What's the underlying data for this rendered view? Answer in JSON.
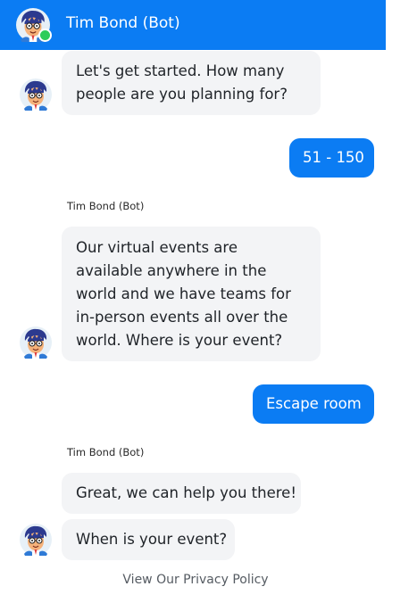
{
  "header": {
    "title": "Tim Bond (Bot)"
  },
  "messages": {
    "bot1": "Let's get started. How many people are you planning for?",
    "user1": "51 - 150",
    "sender2": "Tim Bond (Bot)",
    "bot2": "Our virtual events are available anywhere in the world and we have teams for in-person events all over the world. Where is your event?",
    "user2": "Escape room",
    "sender3": "Tim Bond (Bot)",
    "bot3a": "Great, we can help you there!",
    "bot3b": "When is your event?"
  },
  "footer": {
    "privacy_link": "View Our Privacy Policy"
  },
  "colors": {
    "brand": "#0b7cf3",
    "bubble_bot": "#f3f4f6",
    "online": "#2ecc5b"
  },
  "icons": {
    "avatar": "cartoon-agent-avatar-icon",
    "status": "online-status-icon"
  }
}
